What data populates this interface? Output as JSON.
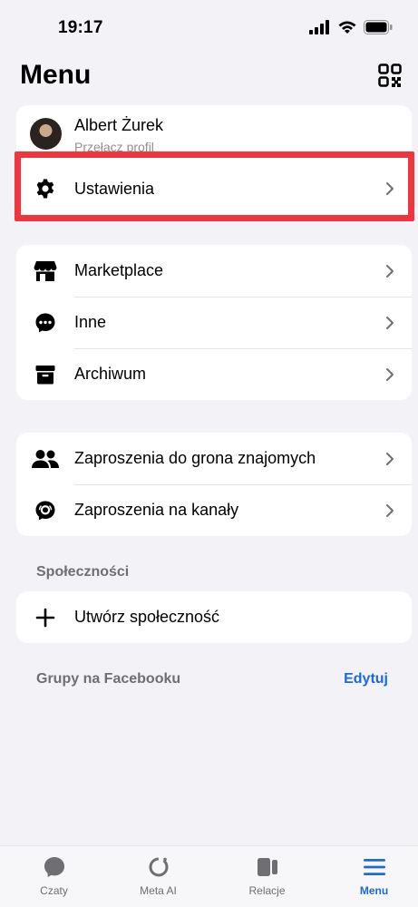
{
  "status": {
    "time": "19:17"
  },
  "header": {
    "title": "Menu"
  },
  "profile": {
    "name": "Albert Żurek",
    "subtitle": "Przełącz profil"
  },
  "settings": {
    "label": "Ustawienia"
  },
  "group1": {
    "items": [
      {
        "label": "Marketplace",
        "icon": "store-icon"
      },
      {
        "label": "Inne",
        "icon": "chat-bubble-dots-icon"
      },
      {
        "label": "Archiwum",
        "icon": "archive-icon"
      }
    ]
  },
  "group2": {
    "items": [
      {
        "label": "Zaproszenia do grona znajomych",
        "icon": "friends-icon"
      },
      {
        "label": "Zaproszenia na kanały",
        "icon": "channel-icon"
      }
    ]
  },
  "communities": {
    "section_title": "Społeczności",
    "create_label": "Utwórz społeczność"
  },
  "facebook_groups": {
    "section_title": "Grupy na Facebooku",
    "edit_label": "Edytuj"
  },
  "tabbar": {
    "tabs": [
      {
        "label": "Czaty",
        "icon": "chat-icon"
      },
      {
        "label": "Meta AI",
        "icon": "meta-ai-icon"
      },
      {
        "label": "Relacje",
        "icon": "stories-icon"
      },
      {
        "label": "Menu",
        "icon": "menu-icon",
        "active": true
      }
    ]
  },
  "colors": {
    "accent": "#1b6bd1",
    "highlight": "#f0353d",
    "background": "#f2f2f7"
  }
}
